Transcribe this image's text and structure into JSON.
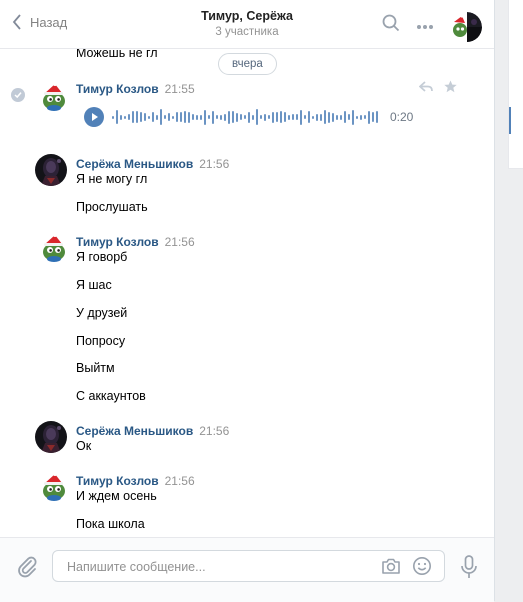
{
  "header": {
    "back_label": "Назад",
    "title": "Тимур, Серёжа",
    "subtitle": "3 участника"
  },
  "feed": {
    "top_fragment": "Можешь не гл",
    "date_pill": "вчера",
    "groups": [
      {
        "author": "Тимур Козлов",
        "time": "21:55",
        "avatar": "pepe-santa-avatar",
        "audio_duration": "0:20",
        "messages": []
      },
      {
        "author": "Серёжа Меньшиков",
        "time": "21:56",
        "avatar": "dark-hero-avatar",
        "messages": [
          "Я не могу гл",
          "Прослушать"
        ]
      },
      {
        "author": "Тимур Козлов",
        "time": "21:56",
        "avatar": "pepe-santa-avatar",
        "messages": [
          "Я говорб",
          "Я шас",
          "У друзей",
          "Попросу",
          "Выйтм",
          "С аккаунтов"
        ]
      },
      {
        "author": "Серёжа Меньшиков",
        "time": "21:56",
        "avatar": "dark-hero-avatar",
        "messages": [
          "Ок"
        ]
      },
      {
        "author": "Тимур Козлов",
        "time": "21:56",
        "avatar": "pepe-santa-avatar",
        "messages": [
          "И ждем осень",
          "Пока школа"
        ]
      }
    ]
  },
  "composer": {
    "placeholder": "Напишите сообщение..."
  },
  "colors": {
    "accent": "#5181b8",
    "author_link": "#2a5885",
    "muted": "#939393"
  },
  "icons": [
    "chevron-left-icon",
    "search-icon",
    "more-icon",
    "reply-icon",
    "star-icon",
    "check-icon",
    "play-icon",
    "paperclip-icon",
    "camera-icon",
    "smile-icon",
    "microphone-icon"
  ]
}
